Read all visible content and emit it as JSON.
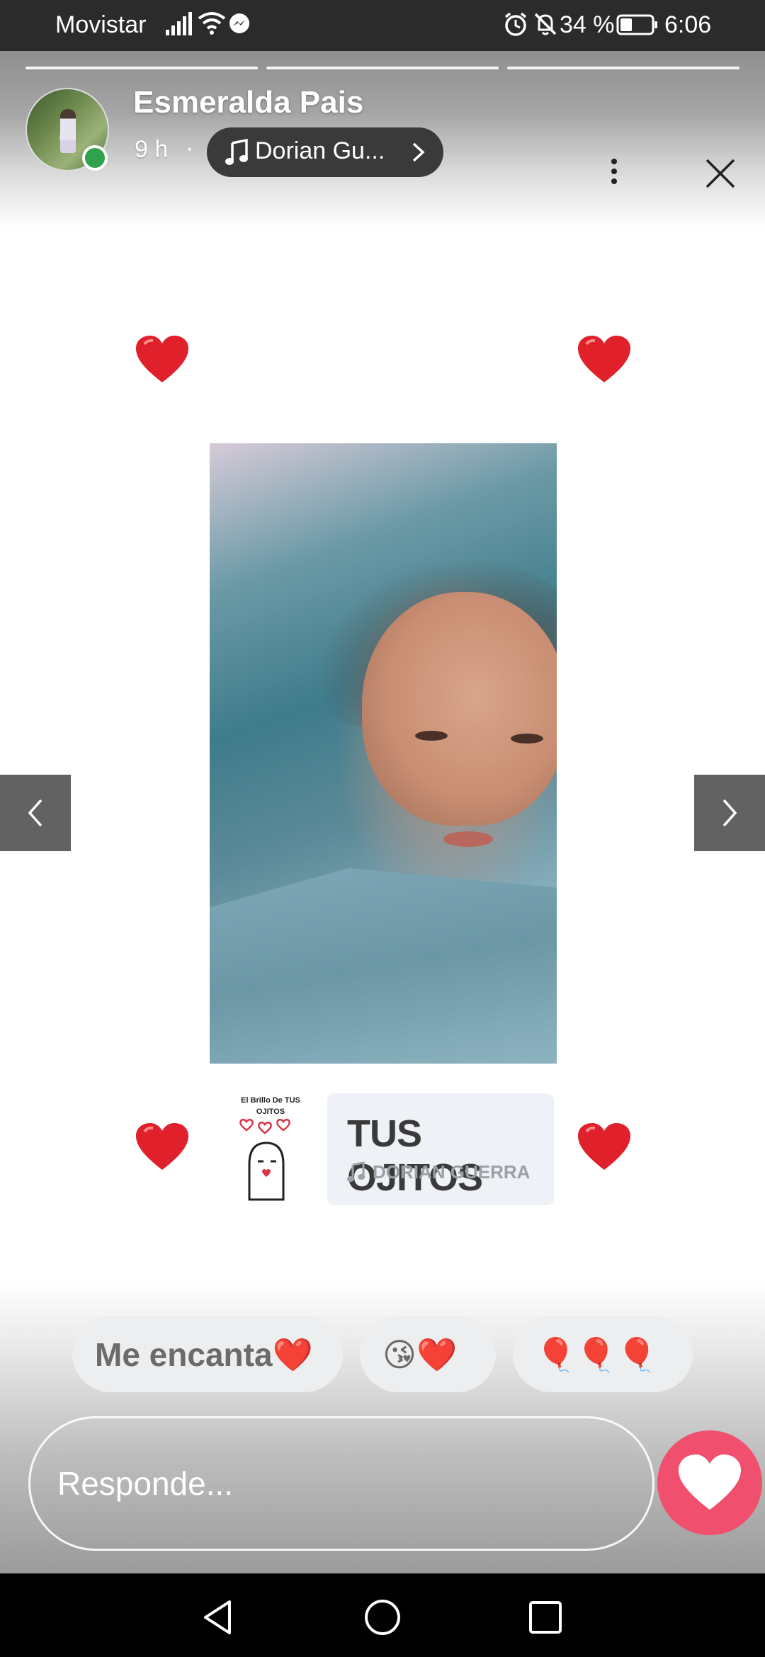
{
  "status_bar": {
    "carrier": "Movistar",
    "battery_percent": "34 %",
    "time": "6:06",
    "icons": [
      "signal-icon",
      "wifi-icon",
      "messenger-icon",
      "alarm-icon",
      "notifications-off-icon",
      "battery-icon"
    ]
  },
  "story": {
    "progress_segments": 3,
    "poster_name": "Esmeralda Pais",
    "time_ago": "9 h",
    "separator": "·",
    "music_label": "Dorian Gu...",
    "sticker_caption": "El Brillo De TUS OJITOS",
    "song_card": {
      "title": "TUS OJITOS",
      "artist": "DORIAN GUERRA"
    }
  },
  "quick_replies": [
    {
      "label": "Me encanta❤️"
    },
    {
      "label": "😘❤️"
    },
    {
      "label": "🎈🎈🎈"
    }
  ],
  "reply": {
    "placeholder": "Responde..."
  },
  "colors": {
    "status_bar": "#2b2b2b",
    "online": "#31a24c",
    "like_button": "#f0506e",
    "heart": "#e0202a"
  }
}
